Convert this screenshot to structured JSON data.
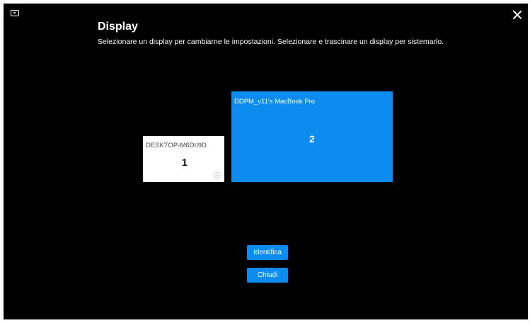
{
  "window": {
    "app_icon": "display-app-icon",
    "close_icon": "close-icon"
  },
  "header": {
    "title": "Display",
    "subtitle": "Selezionare un display per cambiarne le impostazioni. Selezionare e trascinare un display per sistemarlo."
  },
  "displays": [
    {
      "name": "DESKTOP-M6DII9D",
      "number": "1",
      "icon": "settings-icon",
      "color": "#ffffff"
    },
    {
      "name": "DDPM_v11's MacBook Pro",
      "number": "2",
      "color": "#0d8cf0"
    }
  ],
  "actions": {
    "identify_label": "Identifica",
    "close_label": "Chiudi"
  },
  "colors": {
    "background": "#000000",
    "accent": "#0d8cf0"
  }
}
